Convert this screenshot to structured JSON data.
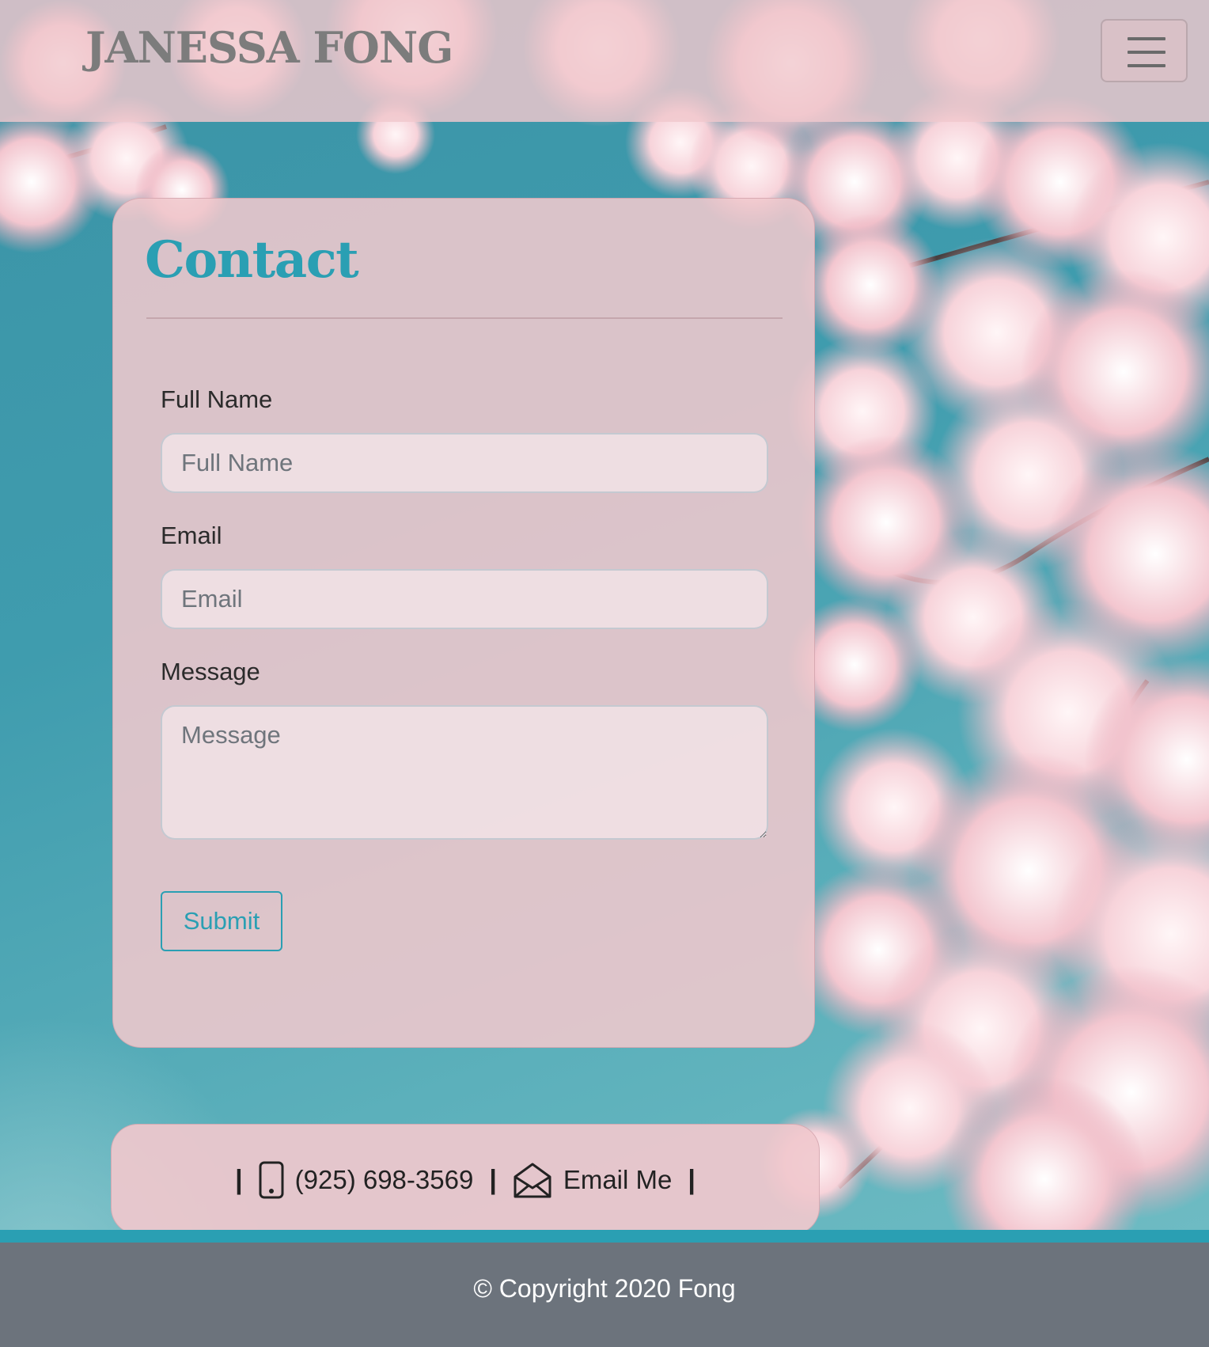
{
  "header": {
    "brand": "JANESSA FONG",
    "menu_icon": "hamburger-menu-icon"
  },
  "contact": {
    "title": "Contact",
    "fields": {
      "name": {
        "label": "Full Name",
        "placeholder": "Full Name",
        "value": ""
      },
      "email": {
        "label": "Email",
        "placeholder": "Email",
        "value": ""
      },
      "message": {
        "label": "Message",
        "placeholder": "Message",
        "value": ""
      }
    },
    "submit_label": "Submit"
  },
  "info": {
    "separator": "|",
    "phone_icon": "mobile-phone-icon",
    "phone": "(925) 698-3569",
    "email_icon": "open-envelope-icon",
    "email_label": "Email Me"
  },
  "footer": {
    "copyright": "© Copyright 2020 Fong"
  },
  "colors": {
    "accent": "#2a9fb3",
    "card_pink": "#f0c8cd",
    "sky": "#3a97a8",
    "footer_gray": "#6c737c",
    "brand_gray": "#7c7c7c"
  }
}
